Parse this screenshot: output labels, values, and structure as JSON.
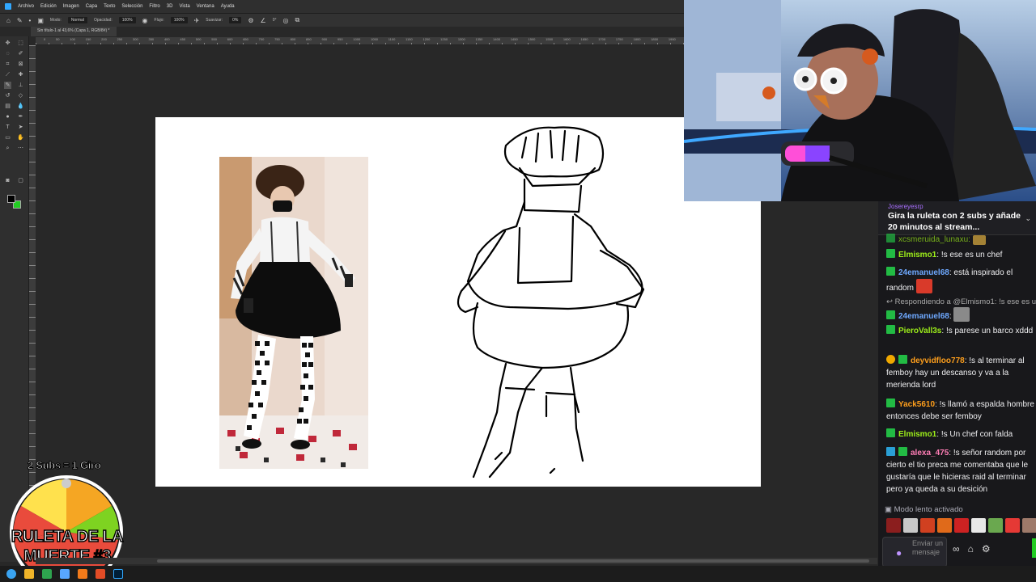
{
  "photoshop": {
    "menu": [
      "Archivo",
      "Edición",
      "Imagen",
      "Capa",
      "Texto",
      "Selección",
      "Filtro",
      "3D",
      "Vista",
      "Ventana",
      "Ayuda"
    ],
    "options": {
      "mode_label": "Modo:",
      "mode_value": "Normal",
      "opacity_label": "Opacidad:",
      "opacity_value": "100%",
      "flow_label": "Flujo:",
      "flow_value": "100%",
      "smooth_label": "Suavizar:",
      "smooth_value": "0%",
      "angle_value": "0°"
    },
    "doc_tab": "Sin título-1 al 43,6% (Capa 1, RGB/8#) *",
    "ruler_labels": [
      "0",
      "50",
      "100",
      "150",
      "200",
      "250",
      "300",
      "350",
      "400",
      "450",
      "500",
      "550",
      "600",
      "650",
      "700",
      "750",
      "800",
      "850",
      "900",
      "950",
      "1000",
      "1050",
      "1100",
      "1150",
      "1200",
      "1250",
      "1300",
      "1350",
      "1400",
      "1450",
      "1500",
      "1550",
      "1600",
      "1650",
      "1700",
      "1750",
      "1800",
      "1850",
      "1900"
    ],
    "colors": {
      "foreground": "#000000",
      "background": "#22cc22"
    }
  },
  "chat": {
    "pinned": {
      "user": "Josereyesrp",
      "text": "Gira la ruleta con 2 subs y añade 20 minutos al stream..."
    },
    "partial_user": "xcsmeruida_lunaxu:",
    "messages": [
      {
        "user": "Elmismo1",
        "color": "#9ef01a",
        "text": "!s ese es un chef"
      },
      {
        "user": "24emanuel68",
        "color": "#6ea8fe",
        "text": "está inspirado el random"
      },
      {
        "user": "24emanuel68",
        "color": "#6ea8fe",
        "text": ""
      },
      {
        "user": "PieroVall3s",
        "color": "#9ef01a",
        "text": "!s parese un barco xddd"
      },
      {
        "user": "deyvidfloo778",
        "color": "#ff9f1c",
        "text": "!s al terminar al femboy hay un descanso y va a la merienda lord"
      },
      {
        "user": "Yack5610",
        "color": "#ff9f1c",
        "text": "!s llamó a espalda hombre entonces debe ser femboy"
      },
      {
        "user": "Elmismo1",
        "color": "#9ef01a",
        "text": "!s Un chef con falda"
      },
      {
        "user": "alexa_475",
        "color": "#ff7eb6",
        "text": "!s señor random por cierto el tio preca me comentaba que le gustaría que le hicieras raid al terminar pero ya queda a su desición"
      }
    ],
    "reply_text": "Respondiendo a @Elmismo1: !s ese es u...",
    "slow_mode": "Modo lento activado",
    "input_placeholder": "Enviar un mensaje"
  },
  "overlay": {
    "subs_text": "2 Subs = 1 Giro",
    "wheel_title_line1": "RULETA DE LA",
    "wheel_title_line2": "MUERTE #3"
  }
}
